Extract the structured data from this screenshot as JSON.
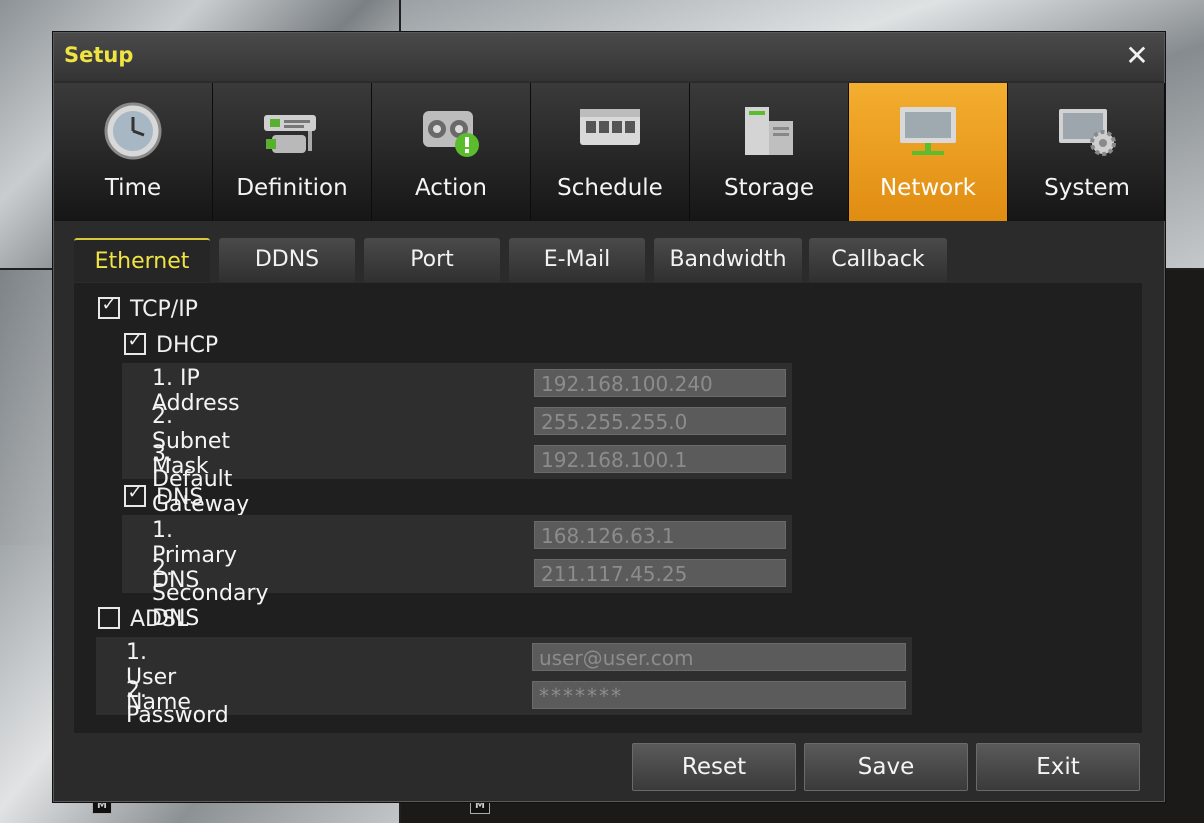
{
  "window": {
    "title": "Setup"
  },
  "toolbar": {
    "items": [
      {
        "label": "Time",
        "icon": "clock-icon"
      },
      {
        "label": "Definition",
        "icon": "camera-definition-icon"
      },
      {
        "label": "Action",
        "icon": "action-alert-icon"
      },
      {
        "label": "Schedule",
        "icon": "schedule-calendar-icon"
      },
      {
        "label": "Storage",
        "icon": "storage-drive-icon"
      },
      {
        "label": "Network",
        "icon": "network-monitor-icon"
      },
      {
        "label": "System",
        "icon": "system-settings-icon"
      }
    ],
    "active": "Network",
    "active_color": "#f0a321"
  },
  "tabs": {
    "items": [
      "Ethernet",
      "DDNS",
      "Port",
      "E-Mail",
      "Bandwidth",
      "Callback"
    ],
    "active": "Ethernet"
  },
  "ethernet": {
    "tcpip": {
      "label": "TCP/IP",
      "checked": true
    },
    "dhcp": {
      "label": "DHCP",
      "checked": true
    },
    "ip_address": {
      "label": "1. IP Address",
      "value": "192.168.100.240"
    },
    "subnet_mask": {
      "label": "2. Subnet Mask",
      "value": "255.255.255.0"
    },
    "default_gateway": {
      "label": "3. Default Gateway",
      "value": "192.168.100.1"
    },
    "dns": {
      "label": "DNS",
      "checked": true
    },
    "primary_dns": {
      "label": "1. Primary DNS",
      "value": "168.126.63.1"
    },
    "secondary_dns": {
      "label": "2. Secondary DNS",
      "value": "211.117.45.25"
    },
    "adsl": {
      "label": "ADSL",
      "checked": false
    },
    "user_name": {
      "label": "1. User Name",
      "value": "user@user.com"
    },
    "password": {
      "label": "2. Password",
      "value": "*******"
    }
  },
  "buttons": {
    "reset": "Reset",
    "save": "Save",
    "exit": "Exit"
  },
  "colors": {
    "title": "#f0e442",
    "active_tab_text": "#f0e442"
  },
  "camera_marks": [
    "M",
    "M"
  ]
}
